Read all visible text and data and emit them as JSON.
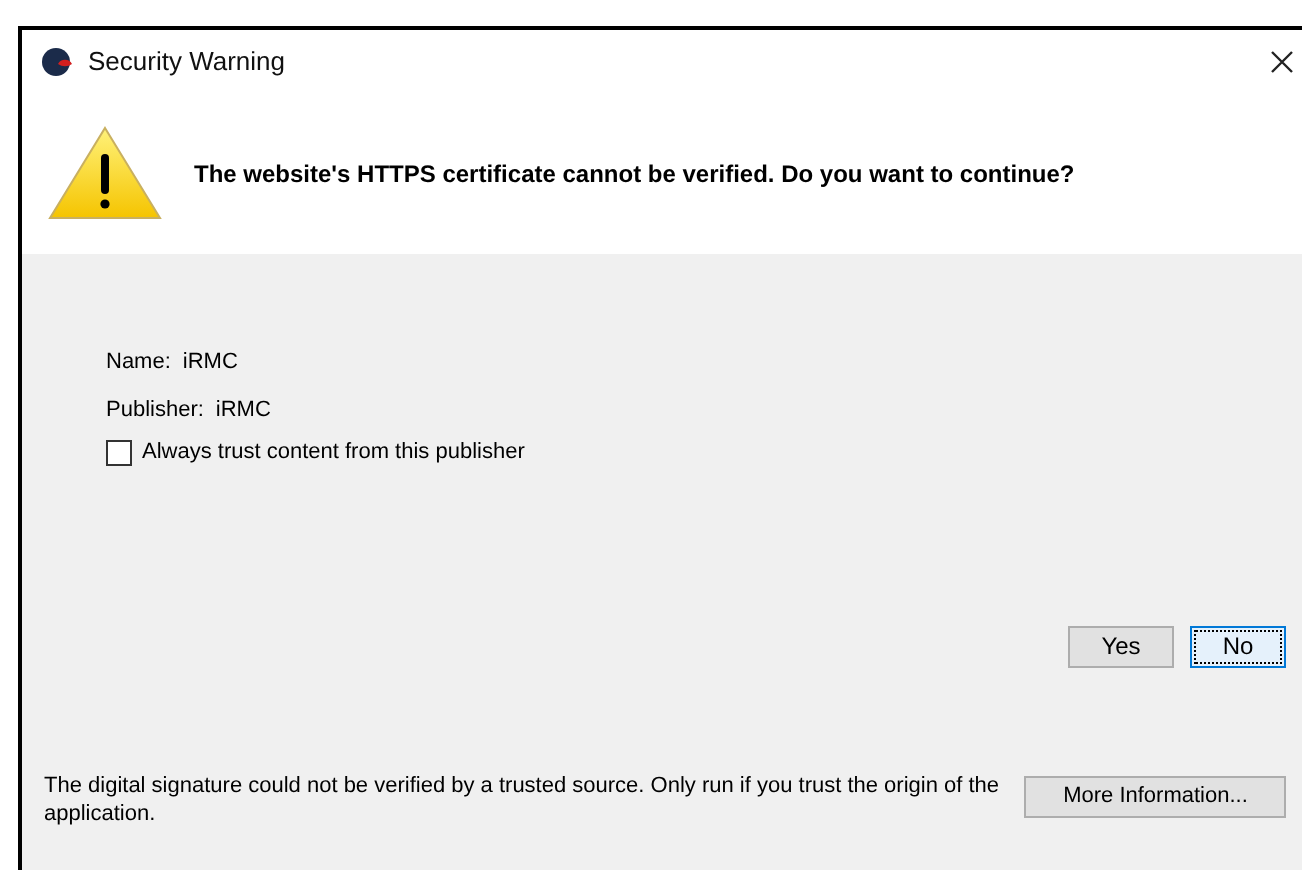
{
  "window": {
    "title": "Security Warning"
  },
  "header": {
    "message": "The website's HTTPS certificate cannot be verified. Do you want to continue?"
  },
  "details": [
    {
      "label": "Name:",
      "value": "iRMC"
    },
    {
      "label": "Publisher:",
      "value": "iRMC"
    }
  ],
  "trust_checkbox": {
    "label": "Always trust content from this publisher",
    "checked": false
  },
  "buttons": [
    {
      "label": "Yes",
      "focused": false
    },
    {
      "label": "No",
      "focused": true
    }
  ],
  "footer": {
    "message": "The digital signature could not be verified by a trusted source. Only run if you trust the origin of the application.",
    "button": "More Information..."
  }
}
